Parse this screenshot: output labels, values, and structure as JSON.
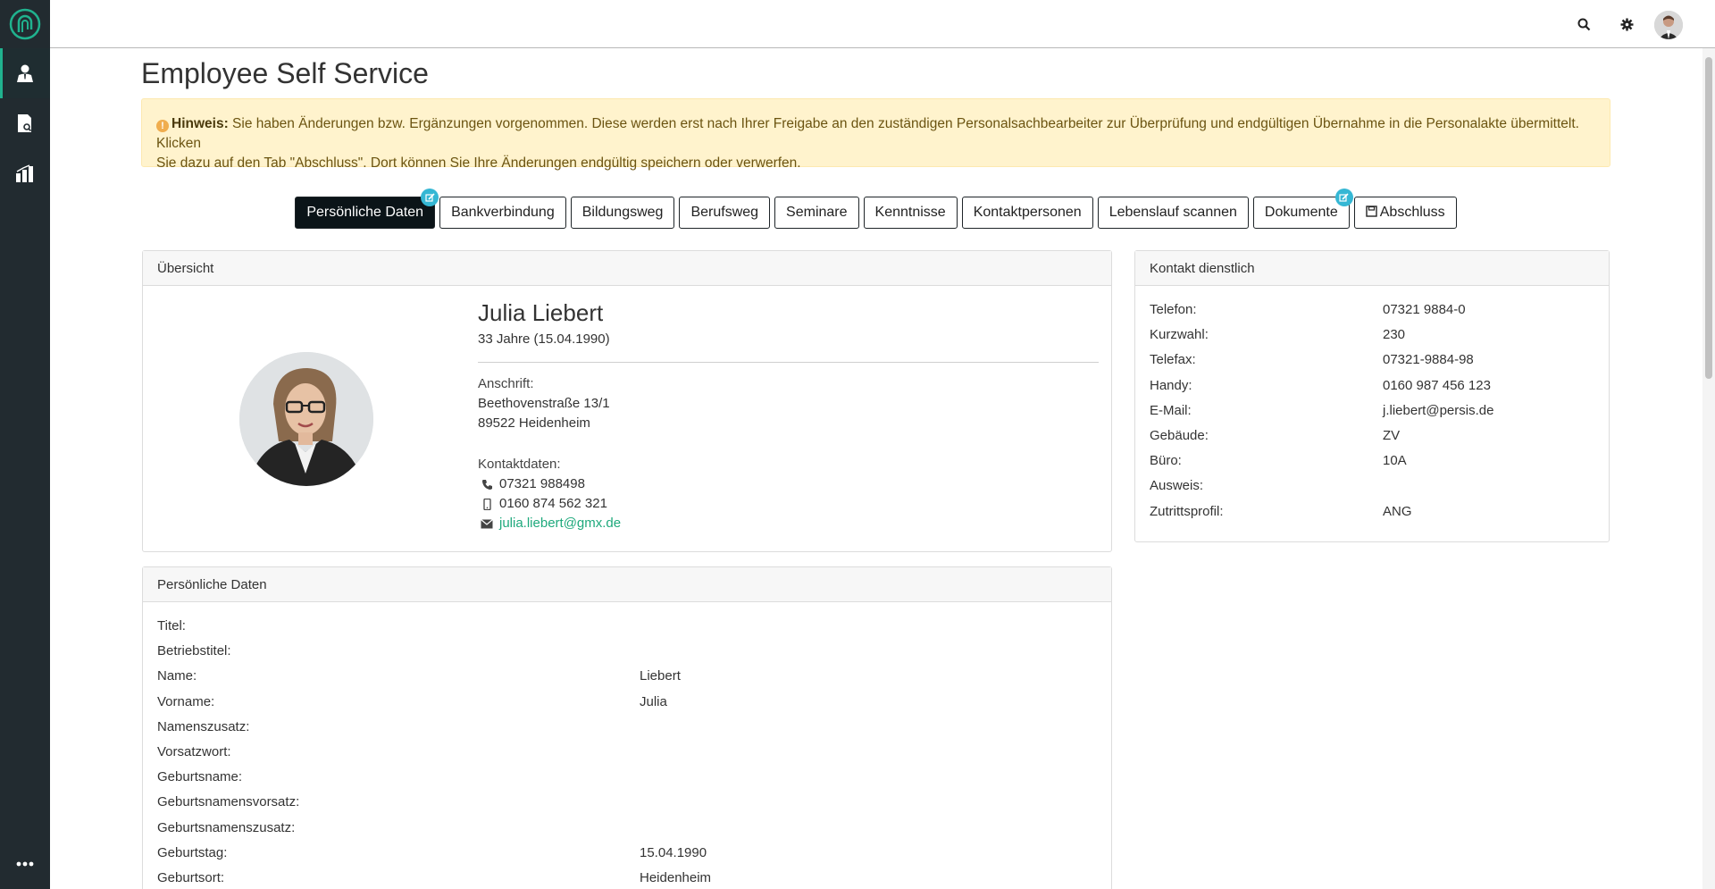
{
  "page": {
    "title": "Employee Self Service"
  },
  "alert": {
    "label": "Hinweis:",
    "line1": "Sie haben Änderungen bzw. Ergänzungen vorgenommen. Diese werden erst nach Ihrer Freigabe an den zuständigen Personalsachbearbeiter zur Überprüfung und endgültigen Übernahme in die Personalakte übermittelt. Klicken",
    "line2": "Sie dazu auf den Tab \"Abschluss\". Dort können Sie Ihre Änderungen endgültig speichern oder verwerfen."
  },
  "tabs": [
    {
      "label": "Persönliche Daten"
    },
    {
      "label": "Bankverbindung"
    },
    {
      "label": "Bildungsweg"
    },
    {
      "label": "Berufsweg"
    },
    {
      "label": "Seminare"
    },
    {
      "label": "Kenntnisse"
    },
    {
      "label": "Kontaktpersonen"
    },
    {
      "label": "Lebenslauf scannen"
    },
    {
      "label": "Dokumente"
    },
    {
      "label": "Abschluss"
    }
  ],
  "overview": {
    "header": "Übersicht",
    "name": "Julia Liebert",
    "age": "33 Jahre (15.04.1990)",
    "address_label": "Anschrift:",
    "street": "Beethovenstraße 13/1",
    "city": "89522 Heidenheim",
    "contact_label": "Kontaktdaten:",
    "phone": "07321 988498",
    "mobile": "0160 874 562 321",
    "email": "julia.liebert@gmx.de"
  },
  "contact": {
    "header": "Kontakt dienstlich",
    "rows": [
      {
        "label": "Telefon:",
        "value": "07321 9884-0"
      },
      {
        "label": "Kurzwahl:",
        "value": "230"
      },
      {
        "label": "Telefax:",
        "value": "07321-9884-98"
      },
      {
        "label": "Handy:",
        "value": "0160 987 456 123"
      },
      {
        "label": "E-Mail:",
        "value": "j.liebert@persis.de"
      },
      {
        "label": "Gebäude:",
        "value": "ZV"
      },
      {
        "label": "Büro:",
        "value": "10A"
      },
      {
        "label": "Ausweis:",
        "value": ""
      },
      {
        "label": "Zutrittsprofil:",
        "value": "ANG"
      }
    ]
  },
  "personal": {
    "header": "Persönliche Daten",
    "rows": [
      {
        "label": "Titel:",
        "value": ""
      },
      {
        "label": "Betriebstitel:",
        "value": ""
      },
      {
        "label": "Name:",
        "value": "Liebert"
      },
      {
        "label": "Vorname:",
        "value": "Julia"
      },
      {
        "label": "Namenszusatz:",
        "value": ""
      },
      {
        "label": "Vorsatzwort:",
        "value": ""
      },
      {
        "label": "Geburtsname:",
        "value": ""
      },
      {
        "label": "Geburtsnamensvorsatz:",
        "value": ""
      },
      {
        "label": "Geburtsnamenszusatz:",
        "value": ""
      },
      {
        "label": "Geburtstag:",
        "value": "15.04.1990"
      },
      {
        "label": "Geburtsort:",
        "value": "Heidenheim"
      }
    ]
  },
  "icons": {
    "logo": "app-logo-icon",
    "nav": [
      "employee-icon",
      "document-search-icon",
      "chart-icon"
    ],
    "more": "more-icon",
    "search": "search-icon",
    "settings": "gear-icon"
  },
  "colors": {
    "sidebar": "#222b30",
    "accent": "#20b28e",
    "alert_bg": "#fff3cd",
    "tab_active": "#0b1418",
    "badge": "#35b7d4",
    "link": "#1ea97c"
  }
}
